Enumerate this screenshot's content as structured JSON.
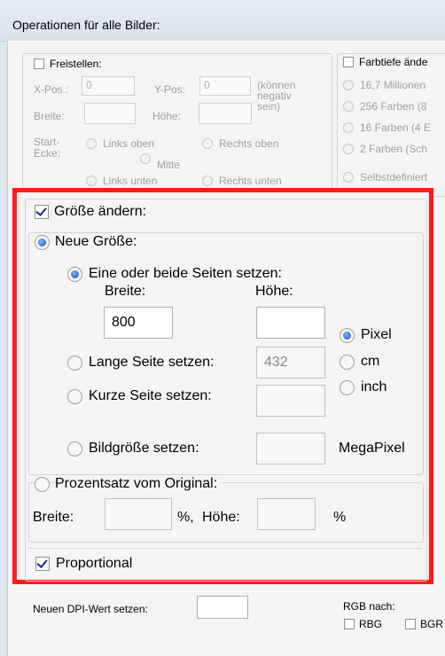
{
  "title": "Operationen für alle Bilder:",
  "freistellen": {
    "label": "Freistellen:",
    "xpos_label": "X-Pos.:",
    "xpos_value": "0",
    "ypos_label": "Y-Pos:",
    "ypos_value": "0",
    "note": "(können negativ sein)",
    "breite_label": "Breite:",
    "hoehe_label": "Höhe:",
    "start_label": "Start-Ecke:",
    "options": [
      "Links oben",
      "Rechts oben",
      "Mitte",
      "Links unten",
      "Rechts unten"
    ]
  },
  "farbtiefe": {
    "label": "Farbtiefe ände",
    "options": [
      "16,7 Millionen",
      "256 Farben (8",
      "16 Farben (4 E",
      "2 Farben (Sch",
      "Selbstdefiniert"
    ]
  },
  "groesse": {
    "checkbox_label": "Größe ändern:",
    "neue_groesse_label": "Neue Größe:",
    "eine_oder_beide_label": "Eine oder beide Seiten setzen:",
    "breite_label": "Breite:",
    "hoehe_label": "Höhe:",
    "breite_value": "800",
    "hoehe_value": "",
    "lange_seite_label": "Lange Seite setzen:",
    "lange_seite_value": "432",
    "kurze_seite_label": "Kurze Seite setzen:",
    "bildgroesse_label": "Bildgröße setzen:",
    "megapixel_label": "MegaPixel",
    "units": [
      "Pixel",
      "cm",
      "inch"
    ],
    "prozentsatz_label": "Prozentsatz vom Original:",
    "pct_breite_label": "Breite:",
    "pct_unit1": "%,",
    "pct_hoehe_label": "Höhe:",
    "pct_unit2": "%",
    "proportional_label": "Proportional"
  },
  "dpi": {
    "label": "Neuen DPI-Wert setzen:"
  },
  "rgb": {
    "label": "RGB nach:",
    "options": [
      "RBG",
      "BGR"
    ]
  }
}
